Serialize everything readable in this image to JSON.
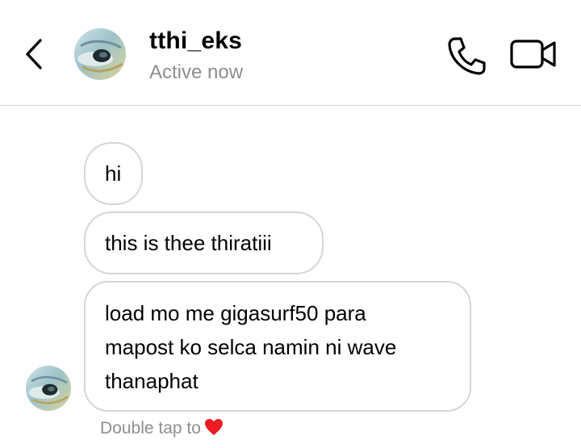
{
  "header": {
    "username": "tthi_eks",
    "status": "Active now",
    "icons": {
      "back": "chevron-left-icon",
      "call": "phone-icon",
      "video": "video-camera-icon"
    }
  },
  "messages": [
    {
      "lines": [
        "hi"
      ]
    },
    {
      "lines": [
        "this is thee thiratiii"
      ]
    },
    {
      "lines": [
        "load mo me gigasurf50 para",
        "mapost ko selca namin ni wave",
        "thanaphat"
      ]
    }
  ],
  "footer": {
    "double_tap_text": "Double tap to",
    "heart_icon": "heart-icon",
    "heart_color": "#ed1c24"
  },
  "colors": {
    "divider": "#dbdbdb",
    "bubble_border": "#d6d6d6",
    "secondary_text": "#8e8e8e"
  }
}
